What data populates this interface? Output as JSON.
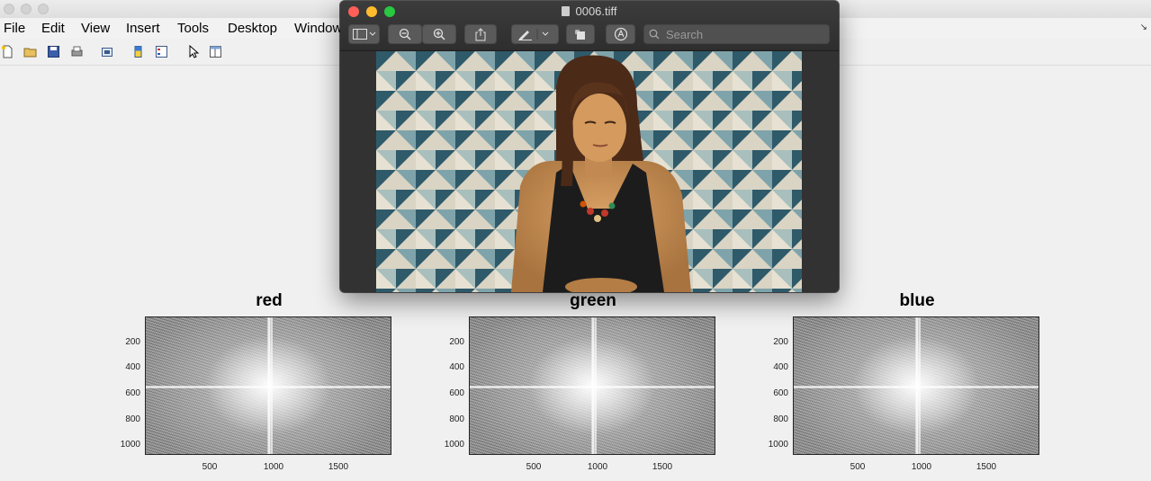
{
  "figure": {
    "menu": [
      "File",
      "Edit",
      "View",
      "Insert",
      "Tools",
      "Desktop",
      "Window"
    ],
    "toolbar_icons": [
      "new-file-icon",
      "open-folder-icon",
      "save-icon",
      "print-icon",
      "export-icon",
      "colorbar-icon",
      "legend-icon",
      "pointer-icon",
      "property-editor-icon"
    ]
  },
  "axes": [
    {
      "title": "red",
      "yticks": [
        "200",
        "400",
        "600",
        "800",
        "1000"
      ],
      "xticks": [
        "500",
        "1000",
        "1500"
      ]
    },
    {
      "title": "green",
      "yticks": [
        "200",
        "400",
        "600",
        "800",
        "1000"
      ],
      "xticks": [
        "500",
        "1000",
        "1500"
      ]
    },
    {
      "title": "blue",
      "yticks": [
        "200",
        "400",
        "600",
        "800",
        "1000"
      ],
      "xticks": [
        "500",
        "1000",
        "1500"
      ]
    }
  ],
  "preview": {
    "title": "0006.tiff",
    "search_placeholder": "Search",
    "colors": {
      "close": "#fe5f57",
      "minimize": "#febc2e",
      "zoom": "#28c840"
    }
  }
}
